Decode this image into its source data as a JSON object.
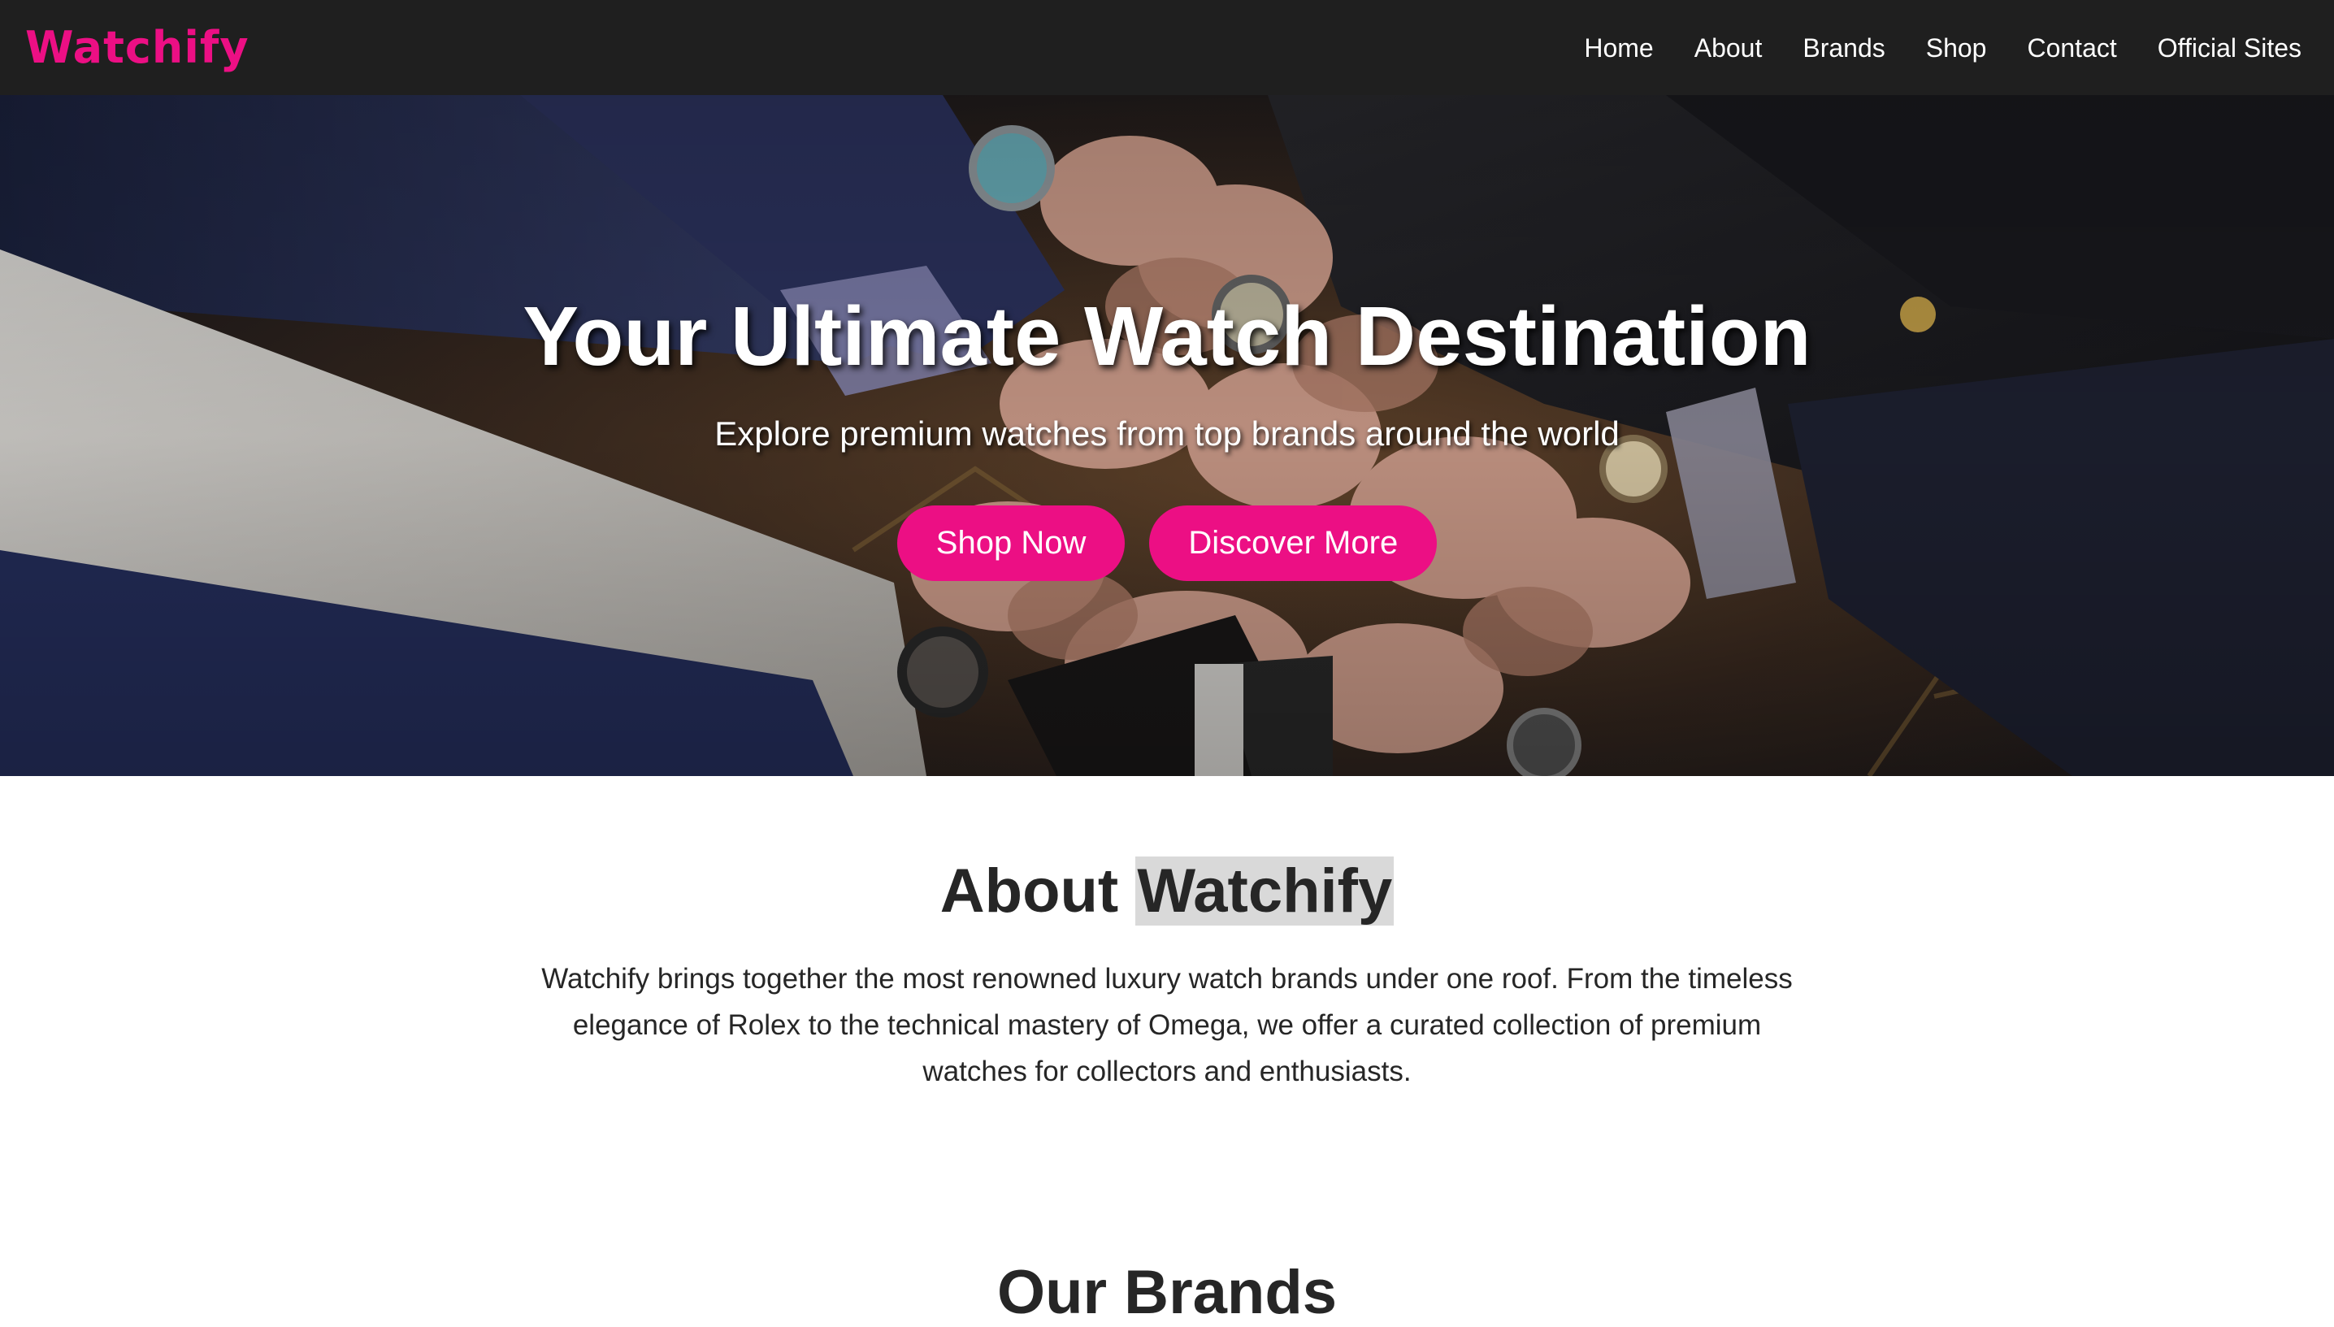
{
  "brand": {
    "logo": "Watchify",
    "accent_color": "#ec0f84"
  },
  "nav": {
    "links": [
      "Home",
      "About",
      "Brands",
      "Shop",
      "Contact",
      "Official Sites"
    ]
  },
  "hero": {
    "title": "Your Ultimate Watch Destination",
    "subtitle": "Explore premium watches from top brands around the world",
    "buttons": {
      "primary": "Shop Now",
      "secondary": "Discover More"
    },
    "background": "photo of many hands wearing wristwatches joined together"
  },
  "about": {
    "title_prefix": "About",
    "title_highlight": "Watchify",
    "text": "Watchify brings together the most renowned luxury watch brands under one roof. From the timeless elegance of Rolex to the technical mastery of Omega, we offer a curated collection of premium watches for collectors and enthusiasts."
  },
  "brands": {
    "title": "Our Brands"
  }
}
